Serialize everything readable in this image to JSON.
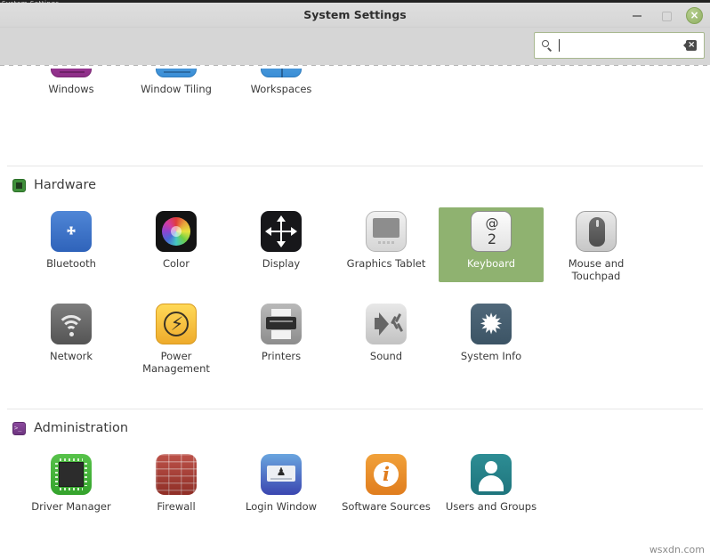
{
  "window": {
    "title": "System Settings",
    "desktop_strip_label": "System Settings",
    "controls": {
      "minimize": "minimize-button",
      "maximize": "maximize-button",
      "close": "×"
    }
  },
  "search": {
    "value": "",
    "placeholder": "",
    "icon": "search-icon",
    "clear_icon": "backspace-clear-icon"
  },
  "clipped_row": {
    "items": [
      {
        "label": "Windows",
        "icon": "windows-icon"
      },
      {
        "label": "Window Tiling",
        "icon": "window-tiling-icon"
      },
      {
        "label": "Workspaces",
        "icon": "workspaces-icon"
      }
    ]
  },
  "sections": [
    {
      "id": "hardware",
      "title": "Hardware",
      "icon": "chip-icon",
      "icon_color": "#3f8f3a",
      "rows": [
        [
          {
            "label": "Bluetooth",
            "icon": "bluetooth-icon",
            "selected": false
          },
          {
            "label": "Color",
            "icon": "color-wheel-icon",
            "selected": false
          },
          {
            "label": "Display",
            "icon": "display-icon",
            "selected": false
          },
          {
            "label": "Graphics Tablet",
            "icon": "graphics-tablet-icon",
            "selected": false
          },
          {
            "label": "Keyboard",
            "icon": "keyboard-key-icon",
            "selected": true
          },
          {
            "label": "Mouse and Touchpad",
            "icon": "mouse-icon",
            "selected": false
          }
        ],
        [
          {
            "label": "Network",
            "icon": "wifi-icon",
            "selected": false
          },
          {
            "label": "Power Management",
            "icon": "power-bolt-icon",
            "selected": false
          },
          {
            "label": "Printers",
            "icon": "printer-icon",
            "selected": false
          },
          {
            "label": "Sound",
            "icon": "speaker-icon",
            "selected": false
          },
          {
            "label": "System Info",
            "icon": "gear-icon",
            "selected": false
          }
        ]
      ]
    },
    {
      "id": "administration",
      "title": "Administration",
      "icon": "terminal-icon",
      "icon_color": "#8c4a9e",
      "rows": [
        [
          {
            "label": "Driver Manager",
            "icon": "driver-chip-icon",
            "selected": false
          },
          {
            "label": "Firewall",
            "icon": "brick-wall-icon",
            "selected": false
          },
          {
            "label": "Login Window",
            "icon": "login-card-icon",
            "selected": false
          },
          {
            "label": "Software Sources",
            "icon": "info-circle-icon",
            "selected": false
          },
          {
            "label": "Users and Groups",
            "icon": "person-icon",
            "selected": false
          }
        ]
      ]
    }
  ],
  "watermark": "wsxdn.com",
  "colors": {
    "selection": "#8fb270",
    "titlebar": "#d6d6d6",
    "close_button": "#8fae62"
  }
}
